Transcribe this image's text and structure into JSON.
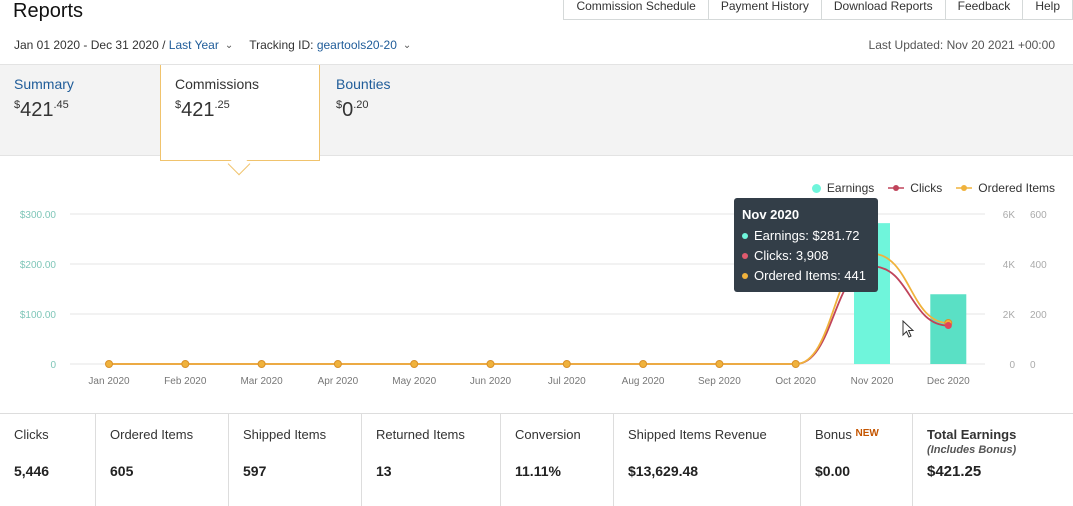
{
  "header": {
    "title": "Reports",
    "nav": [
      "Commission Schedule",
      "Payment History",
      "Download Reports",
      "Feedback",
      "Help"
    ],
    "date_range": "Jan 01 2020 - Dec 31 2020 /",
    "range_label": "Last Year",
    "tracking_label": "Tracking ID:",
    "tracking_id": "geartools20-20",
    "last_updated": "Last Updated: Nov 20 2021 +00:00"
  },
  "tabs": [
    {
      "label": "Summary",
      "currency": "$",
      "whole": "421",
      "cents": ".45"
    },
    {
      "label": "Commissions",
      "currency": "$",
      "whole": "421",
      "cents": ".25"
    },
    {
      "label": "Bounties",
      "currency": "$",
      "whole": "0",
      "cents": ".20"
    }
  ],
  "legend": {
    "earnings": "Earnings",
    "clicks": "Clicks",
    "ordered": "Ordered Items"
  },
  "tooltip": {
    "title": "Nov 2020",
    "earnings": "Earnings: $281.72",
    "clicks": "Clicks: 3,908",
    "ordered": "Ordered Items: 441"
  },
  "colors": {
    "earnings": "#6ff5db",
    "clicks": "#c0445b",
    "ordered": "#f0b23c",
    "tooltip_bg": "#333e48"
  },
  "chart_data": {
    "type": "bar",
    "categories": [
      "Jan 2020",
      "Feb 2020",
      "Mar 2020",
      "Apr 2020",
      "May 2020",
      "Jun 2020",
      "Jul 2020",
      "Aug 2020",
      "Sep 2020",
      "Oct 2020",
      "Nov 2020",
      "Dec 2020"
    ],
    "series": [
      {
        "name": "Earnings",
        "type": "bar",
        "axis": "left",
        "values": [
          0,
          0,
          0,
          0,
          0,
          0,
          0,
          0,
          0,
          0,
          281.72,
          139.5
        ]
      },
      {
        "name": "Clicks",
        "type": "line",
        "axis": "right1",
        "values": [
          0,
          0,
          0,
          0,
          0,
          0,
          0,
          0,
          0,
          0,
          3908,
          1538
        ]
      },
      {
        "name": "Ordered Items",
        "type": "line",
        "axis": "right2",
        "values": [
          0,
          0,
          0,
          0,
          0,
          0,
          0,
          0,
          0,
          0,
          441,
          164
        ]
      }
    ],
    "left_ticks": [
      "0",
      "$100.00",
      "$200.00",
      "$300.00"
    ],
    "left_ylim": [
      0,
      300
    ],
    "right1_ticks": [
      "0",
      "2K",
      "4K",
      "6K"
    ],
    "right1_ylim": [
      0,
      6000
    ],
    "right2_ticks": [
      "0",
      "200",
      "400",
      "600"
    ],
    "right2_ylim": [
      0,
      600
    ],
    "grid": true,
    "legend_position": "top-right"
  },
  "stats": [
    {
      "label": "Clicks",
      "value": "5,446"
    },
    {
      "label": "Ordered Items",
      "value": "605"
    },
    {
      "label": "Shipped Items",
      "value": "597"
    },
    {
      "label": "Returned Items",
      "value": "13"
    },
    {
      "label": "Conversion",
      "value": "11.11%"
    },
    {
      "label": "Shipped Items Revenue",
      "value": "$13,629.48"
    },
    {
      "label": "Bonus",
      "badge": "NEW",
      "value": "$0.00"
    },
    {
      "label": "Total Earnings",
      "sub": "(Includes Bonus)",
      "value": "$421.25"
    }
  ]
}
